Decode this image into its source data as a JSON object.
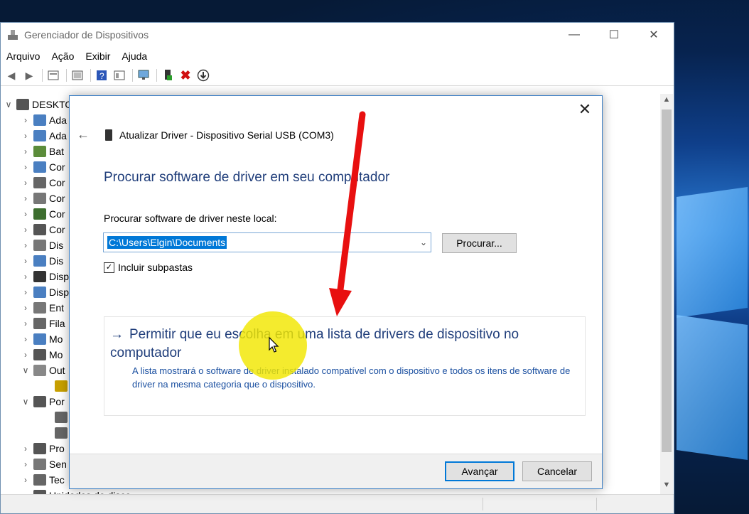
{
  "window": {
    "title": "Gerenciador de Dispositivos",
    "controls": [
      "minimize",
      "maximize",
      "close"
    ]
  },
  "menu": [
    "Arquivo",
    "Ação",
    "Exibir",
    "Ajuda"
  ],
  "toolbar": [
    "back-icon",
    "forward-icon",
    "properties-icon",
    "show-hide-icon",
    "help-icon",
    "view-icon",
    "scan-icon",
    "update-driver-icon",
    "uninstall-icon",
    "disable-icon"
  ],
  "tree": {
    "root": "DESKTO",
    "items": [
      "Ada",
      "Ada",
      "Bat",
      "Cor",
      "Cor",
      "Cor",
      "Cor",
      "Cor",
      "Dis",
      "Dis",
      "Disp",
      "Disp",
      "Ent",
      "Fila",
      "Mo",
      "Mo",
      "Out",
      "",
      "Por",
      "",
      "",
      "Pro",
      "Sen",
      "Tec",
      "Unidades de disco"
    ]
  },
  "dialog": {
    "header": "Atualizar Driver -  Dispositivo Serial USB (COM3)",
    "heading": "Procurar software de driver em seu computador",
    "location_label": "Procurar software de driver neste local:",
    "location_value": "C:\\Users\\Elgin\\Documents",
    "browse_button": "Procurar...",
    "include_subfolders": "Incluir subpastas",
    "include_subfolders_checked": true,
    "pick_link": "Permitir que eu escolha em uma lista de drivers de dispositivo no computador",
    "pick_description": "A lista mostrará o software de driver instalado compatível com o dispositivo e todos os itens de software de driver na mesma categoria que o dispositivo.",
    "next_button": "Avançar",
    "cancel_button": "Cancelar"
  },
  "colors": {
    "accent": "#0078d7",
    "heading": "#1f3d7a",
    "annotation_arrow": "#e81010",
    "highlight": "#f2e600"
  }
}
